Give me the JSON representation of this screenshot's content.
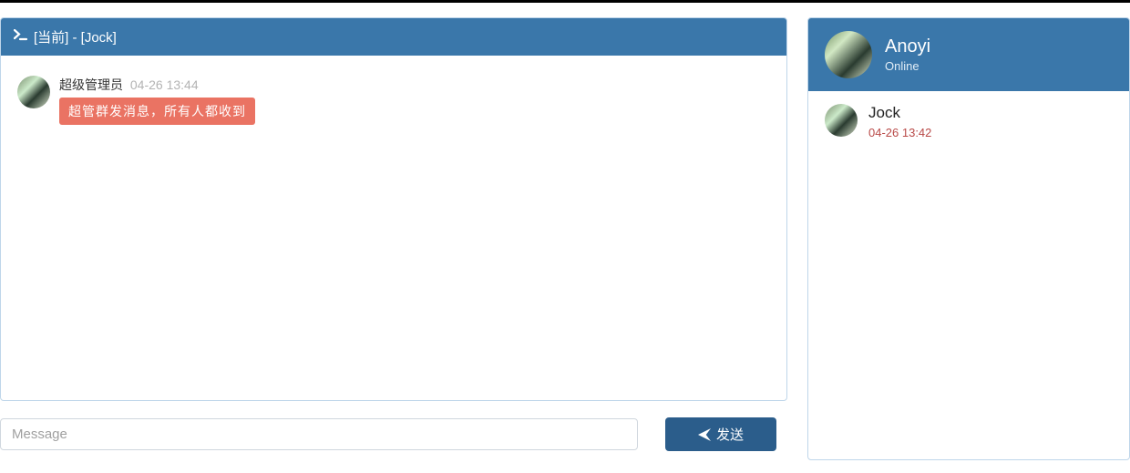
{
  "colors": {
    "primary": "#3a77aa",
    "danger_bubble": "#ea7363",
    "send_button": "#2b5d8b"
  },
  "chat": {
    "header_prefix": "[当前]",
    "header_separator": " - ",
    "header_target": "[Jock]",
    "header_full": "[当前] - [Jock]",
    "messages": [
      {
        "sender": "超级管理员",
        "time": "04-26 13:44",
        "body": "超管群发消息，所有人都收到",
        "bubble_style": "red"
      }
    ]
  },
  "input": {
    "placeholder": "Message",
    "send_label": "发送"
  },
  "profile": {
    "name": "Anoyi",
    "status": "Online"
  },
  "contacts": [
    {
      "name": "Jock",
      "time": "04-26 13:42"
    }
  ]
}
